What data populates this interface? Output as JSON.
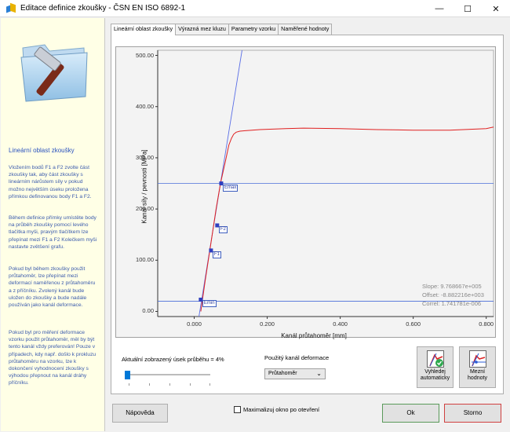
{
  "window": {
    "title": "Editace definice zkoušky - ČSN EN ISO 6892-1",
    "minimize": "—",
    "maximize": "☐",
    "close": "✕"
  },
  "leftpane": {
    "heading": "Lineární oblast zkoušky",
    "paragraphs": [
      "Vložením bodů F1 a F2 zvolte část zkoušky tak, aby část zkoušky s lineárním nárůstem síly v pokud možno největším úseku proložena přímkou definovanou body F1 a F2.",
      "Během definice přímky umístěte body na průběh zkoušky pomocí levého tlačítka myši, pravým tlačítkem lze přepínat mezi F1 a F2 Kolečkem myši nastavte zvětšení grafu.",
      "Pokud byl během zkoušky použit průtahoměr, lze přepínat mezi deformací naměřenou z průtahoměru a z příčníku. Zvolený kanál bude uložen do zkoušky a bude nadále používán jako kanál deformace.",
      "Pokud byl pro měření deformace vzorku použit průtahoměr, měl by být tento kanál vždy preferován! Pouze v případech, kdy např. došlo k prokluzu průtahoměru na vzorku, lze k dokončení vyhodnocení zkoušky s výhodou přepnout na kanál dráhy příčníku."
    ]
  },
  "tabs": [
    {
      "label": "Lineární oblast zkoušky",
      "active": true
    },
    {
      "label": "Výrazná mez kluzu",
      "active": false
    },
    {
      "label": "Parametry vzorku",
      "active": false
    },
    {
      "label": "Naměřené hodnoty",
      "active": false
    }
  ],
  "chart_data": {
    "type": "line",
    "xlabel": "Kanál průtahoměr [mm]",
    "ylabel": "Kanál síly / pevnosti [MPa]",
    "xlim": [
      -0.1,
      0.82
    ],
    "ylim": [
      -10,
      510
    ],
    "x_ticks": [
      "0.000",
      "0.200",
      "0.400",
      "0.600",
      "0.800"
    ],
    "x_tick_values": [
      0,
      0.2,
      0.4,
      0.6,
      0.8
    ],
    "y_ticks": [
      "0.00",
      "100.00",
      "200.00",
      "300.00",
      "400.00",
      "500.00"
    ],
    "y_tick_values": [
      0,
      100,
      200,
      300,
      400,
      500
    ],
    "series": [
      {
        "color": "#e02020",
        "x": [
          0.018,
          0.03,
          0.045,
          0.06,
          0.072,
          0.085,
          0.095,
          0.102,
          0.108,
          0.115,
          0.125,
          0.14,
          0.18,
          0.25,
          0.3,
          0.4,
          0.5,
          0.6,
          0.7,
          0.8,
          0.82
        ],
        "y": [
          0,
          60,
          130,
          200,
          250,
          292,
          325,
          338,
          346,
          350,
          352,
          353,
          355,
          357,
          358,
          357,
          355,
          354,
          354,
          357,
          360
        ]
      }
    ],
    "fit_line": {
      "color": "#5a6ee6",
      "x": [
        0.013,
        0.131
      ],
      "y": [
        -10,
        510
      ]
    },
    "horizontal_lines": [
      {
        "y": 250,
        "color": "#4a6ed9"
      },
      {
        "y": 20,
        "color": "#4a6ed9"
      }
    ],
    "points": [
      {
        "label": "Emax",
        "x": 0.074,
        "y": 250
      },
      {
        "label": "F2",
        "x": 0.063,
        "y": 168
      },
      {
        "label": "F1",
        "x": 0.046,
        "y": 119
      },
      {
        "label": "Emin",
        "x": 0.018,
        "y": 23
      }
    ],
    "stats": [
      "Slope: 9.768667e+005",
      "Offset: -8.882216e+003",
      "Correl: 1.741781e-006"
    ],
    "grid": false
  },
  "controls": {
    "slider_label": "Aktuální zobrazený úsek průběhu = 4%",
    "slider_value": 0.04,
    "channel_label": "Použitý kanál deformace",
    "channel_value": "Průtahoměr",
    "auto_button": "Vyhledej automaticky",
    "limits_button": "Mezní hodnoty"
  },
  "footer": {
    "help_button": "Nápověda",
    "maximize_checkbox": "Maximalizuj okno po otevření",
    "ok_button": "Ok",
    "cancel_button": "Storno"
  },
  "colors": {
    "accent": "#0078d7",
    "curve": "#e02020",
    "fit_line": "#5a6ee6",
    "info_text": "#3b5bad",
    "pane_bg": "#ffffe6"
  }
}
